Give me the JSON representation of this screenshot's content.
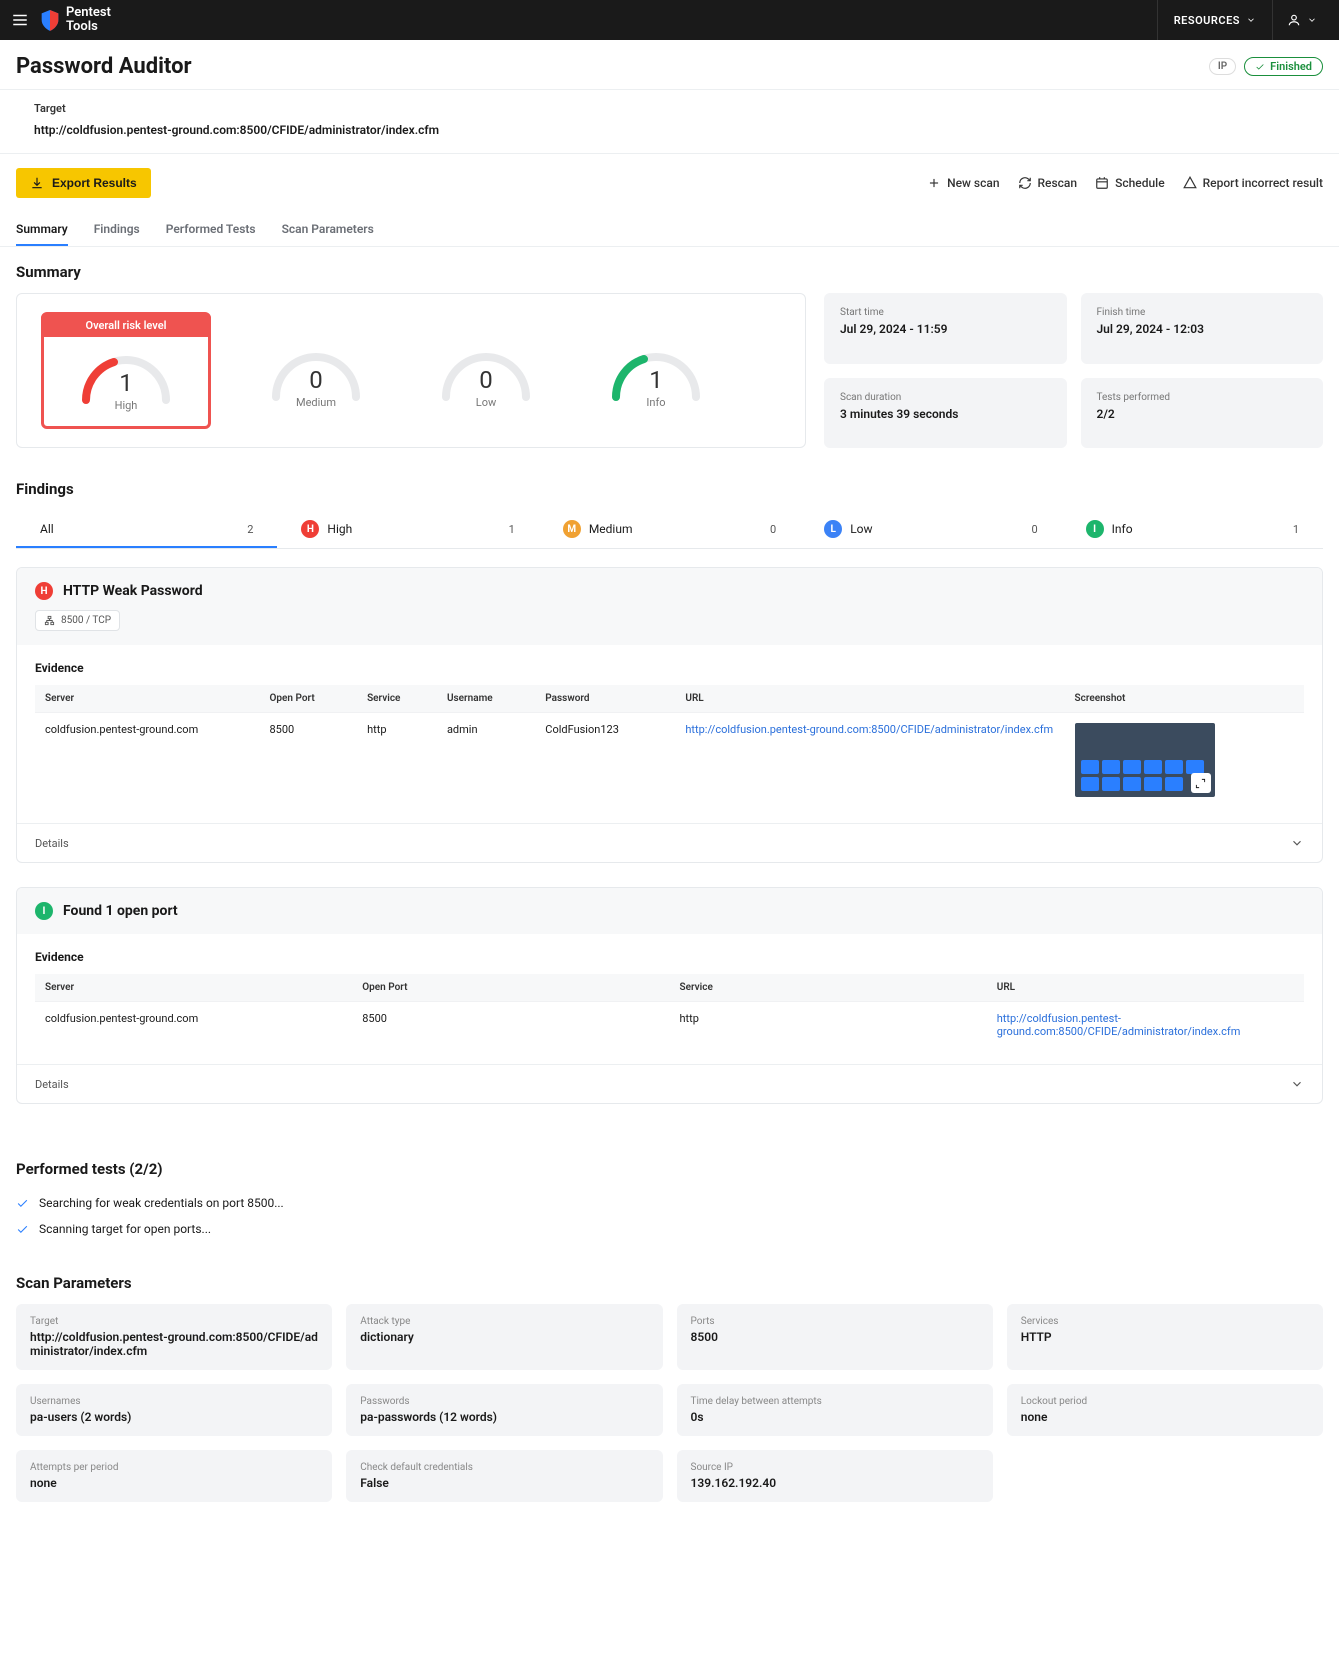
{
  "app": {
    "brand_top": "Pentest",
    "brand_bottom": "Tools",
    "resources": "RESOURCES"
  },
  "header": {
    "title": "Password Auditor",
    "ip_label": "IP",
    "status": "Finished",
    "target_label": "Target",
    "target": "http://coldfusion.pentest-ground.com:8500/CFIDE/administrator/index.cfm"
  },
  "actions": {
    "export": "Export Results",
    "new_scan": "New scan",
    "rescan": "Rescan",
    "schedule": "Schedule",
    "report_incorrect": "Report incorrect result"
  },
  "tabs": {
    "summary": "Summary",
    "findings": "Findings",
    "performed": "Performed Tests",
    "params": "Scan Parameters"
  },
  "summary": {
    "heading": "Summary",
    "overall_label": "Overall risk level",
    "gauges": {
      "high": {
        "value": "1",
        "label": "High"
      },
      "medium": {
        "value": "0",
        "label": "Medium"
      },
      "low": {
        "value": "0",
        "label": "Low"
      },
      "info": {
        "value": "1",
        "label": "Info"
      }
    },
    "info": {
      "start_label": "Start time",
      "start_value": "Jul 29, 2024 - 11:59",
      "finish_label": "Finish time",
      "finish_value": "Jul 29, 2024 - 12:03",
      "duration_label": "Scan duration",
      "duration_value": "3 minutes 39 seconds",
      "tests_label": "Tests performed",
      "tests_value": "2/2"
    }
  },
  "findings": {
    "heading": "Findings",
    "tabs": {
      "all": {
        "label": "All",
        "count": "2"
      },
      "high": {
        "label": "High",
        "count": "1"
      },
      "medium": {
        "label": "Medium",
        "count": "0"
      },
      "low": {
        "label": "Low",
        "count": "0"
      },
      "info": {
        "label": "Info",
        "count": "1"
      }
    },
    "items": [
      {
        "severity": "H",
        "title": "HTTP Weak Password",
        "port_chip": "8500 / TCP",
        "evidence_label": "Evidence",
        "columns": [
          "Server",
          "Open Port",
          "Service",
          "Username",
          "Password",
          "URL",
          "Screenshot"
        ],
        "row": {
          "server": "coldfusion.pentest-ground.com",
          "port": "8500",
          "service": "http",
          "username": "admin",
          "password": "ColdFusion123",
          "url": "http://coldfusion.pentest-ground.com:8500/CFIDE/administrator/index.cfm"
        },
        "details": "Details"
      },
      {
        "severity": "I",
        "title": "Found 1 open port",
        "evidence_label": "Evidence",
        "columns": [
          "Server",
          "Open Port",
          "Service",
          "URL"
        ],
        "row": {
          "server": "coldfusion.pentest-ground.com",
          "port": "8500",
          "service": "http",
          "url": "http://coldfusion.pentest-ground.com:8500/CFIDE/administrator/index.cfm"
        },
        "details": "Details"
      }
    ]
  },
  "performed": {
    "heading": "Performed tests (2/2)",
    "items": [
      "Searching for weak credentials on port 8500...",
      "Scanning target for open ports..."
    ]
  },
  "params": {
    "heading": "Scan Parameters",
    "rows": [
      {
        "label": "Target",
        "value": "http://coldfusion.pentest-ground.com:8500/CFIDE/administrator/index.cfm"
      },
      {
        "label": "Attack type",
        "value": "dictionary"
      },
      {
        "label": "Ports",
        "value": "8500"
      },
      {
        "label": "Services",
        "value": "HTTP"
      },
      {
        "label": "Usernames",
        "value": "pa-users (2 words)"
      },
      {
        "label": "Passwords",
        "value": "pa-passwords (12 words)"
      },
      {
        "label": "Time delay between attempts",
        "value": "0s"
      },
      {
        "label": "Lockout period",
        "value": "none"
      },
      {
        "label": "Attempts per period",
        "value": "none"
      },
      {
        "label": "Check default credentials",
        "value": "False"
      },
      {
        "label": "Source IP",
        "value": "139.162.192.40"
      }
    ]
  }
}
